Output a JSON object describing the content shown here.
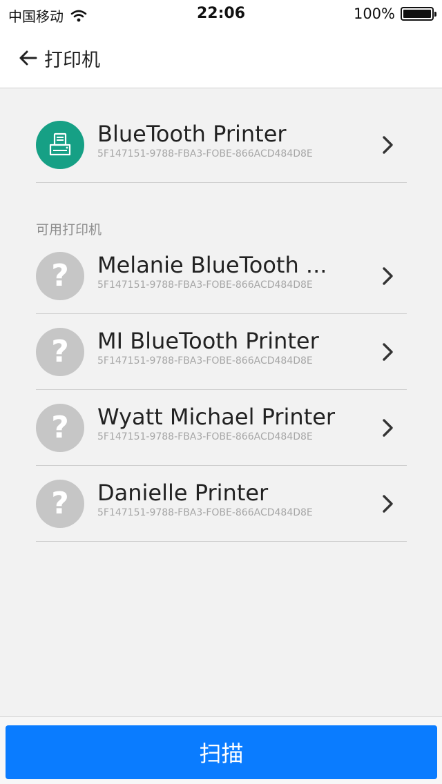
{
  "status_bar": {
    "carrier": "中国移动",
    "time": "22:06",
    "battery_text": "100%"
  },
  "nav": {
    "title": "打印机"
  },
  "connected_device": {
    "name": "BlueTooth Printer",
    "id": "5F147151-9788-FBA3-FOBE-866ACD484D8E",
    "icon": "printer-icon"
  },
  "available_section": {
    "title": "可用打印机",
    "devices": [
      {
        "name": "Melanie BlueTooth ...",
        "id": "5F147151-9788-FBA3-FOBE-866ACD484D8E",
        "icon": "question-icon"
      },
      {
        "name": "MI BlueTooth Printer",
        "id": "5F147151-9788-FBA3-FOBE-866ACD484D8E",
        "icon": "question-icon"
      },
      {
        "name": "Wyatt Michael Printer",
        "id": "5F147151-9788-FBA3-FOBE-866ACD484D8E",
        "icon": "question-icon"
      },
      {
        "name": "Danielle Printer",
        "id": "5F147151-9788-FBA3-FOBE-866ACD484D8E",
        "icon": "question-icon"
      }
    ]
  },
  "scan_button": {
    "label": "扫描"
  },
  "colors": {
    "accent_blue": "#0a7cff",
    "connected_green": "#16a085",
    "unknown_gray": "#c6c6c6",
    "background": "#f2f2f2"
  }
}
